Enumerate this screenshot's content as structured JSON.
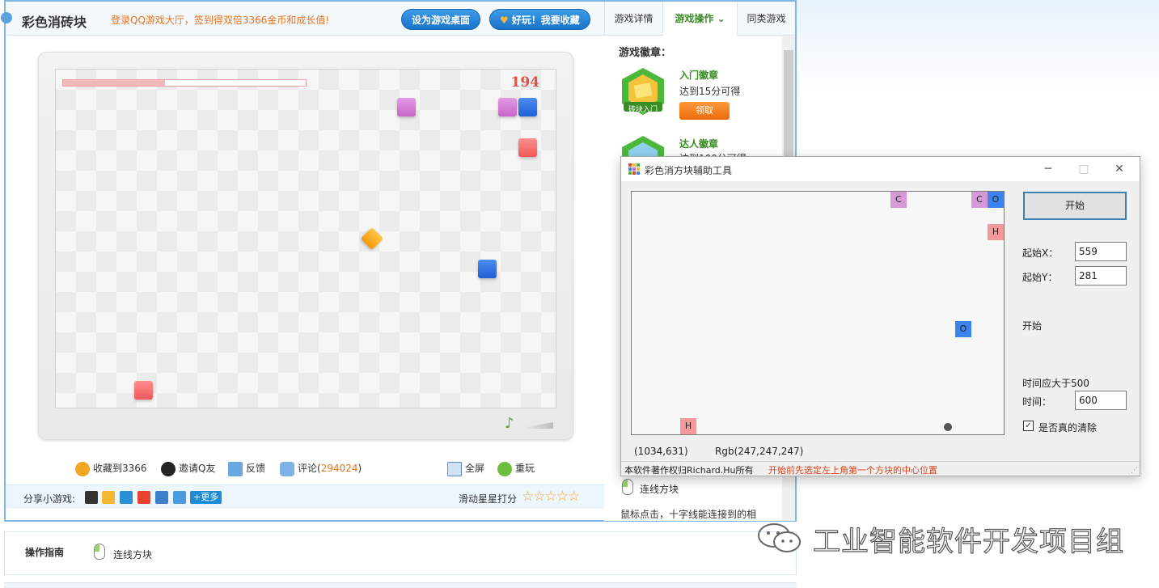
{
  "game": {
    "title": "彩色消砖块",
    "promo": "登录QQ游戏大厅，签到得双倍3366金币和成长值!",
    "btn_desktop": "设为游戏桌面",
    "btn_fav": "好玩！我要收藏",
    "score": "194",
    "progress": 0.42,
    "actions": {
      "fav": "收藏到3366",
      "invite": "邀请Q友",
      "feedback": "反馈",
      "comment": "评论(",
      "comment_count": "294024",
      "comment_close": ")",
      "fullscreen": "全屏",
      "replay": "重玩"
    },
    "share_label": "分享小游戏:",
    "more": "更多",
    "rate_label": "滑动星星打分",
    "stars": "☆☆☆☆☆"
  },
  "side": {
    "tabs": [
      "游戏详情",
      "游戏操作",
      "同类游戏"
    ],
    "badge_title": "游戏徽章：",
    "badge1_name": "入门徽章",
    "badge1_desc": "达到15分可得",
    "badge1_img_text": "砖块入门",
    "claim": "领取",
    "badge2_name": "达人徽章",
    "badge2_desc": "达到100分可得",
    "connect": "连线方块",
    "connect_desc": "鼠标点击，十字线能连接到的相"
  },
  "guide": {
    "title": "操作指南",
    "text": "连线方块"
  },
  "tool": {
    "title": "彩色消方块辅助工具",
    "start_btn": "开始",
    "start_x_label": "起始X：",
    "start_x": "559",
    "start_y_label": "起始Y：",
    "start_y": "281",
    "status": "开始",
    "time_hint": "时间应大于500",
    "time_label": "时间：",
    "time": "600",
    "check_label": "是否真的清除",
    "coord": "(1034,631)",
    "rgb": "Rgb(247,247,247)",
    "copyright": "本软件著作权归Richard.Hu所有",
    "tip": "开始前先选定左上角第一个方块的中心位置",
    "cells": [
      {
        "letter": "C",
        "color": "purple"
      },
      {
        "letter": "C",
        "color": "purple"
      },
      {
        "letter": "O",
        "color": "blue"
      },
      {
        "letter": "H",
        "color": "red"
      },
      {
        "letter": "O",
        "color": "blue"
      },
      {
        "letter": "H",
        "color": "red"
      }
    ]
  },
  "watermark": "工业智能软件开发项目组"
}
